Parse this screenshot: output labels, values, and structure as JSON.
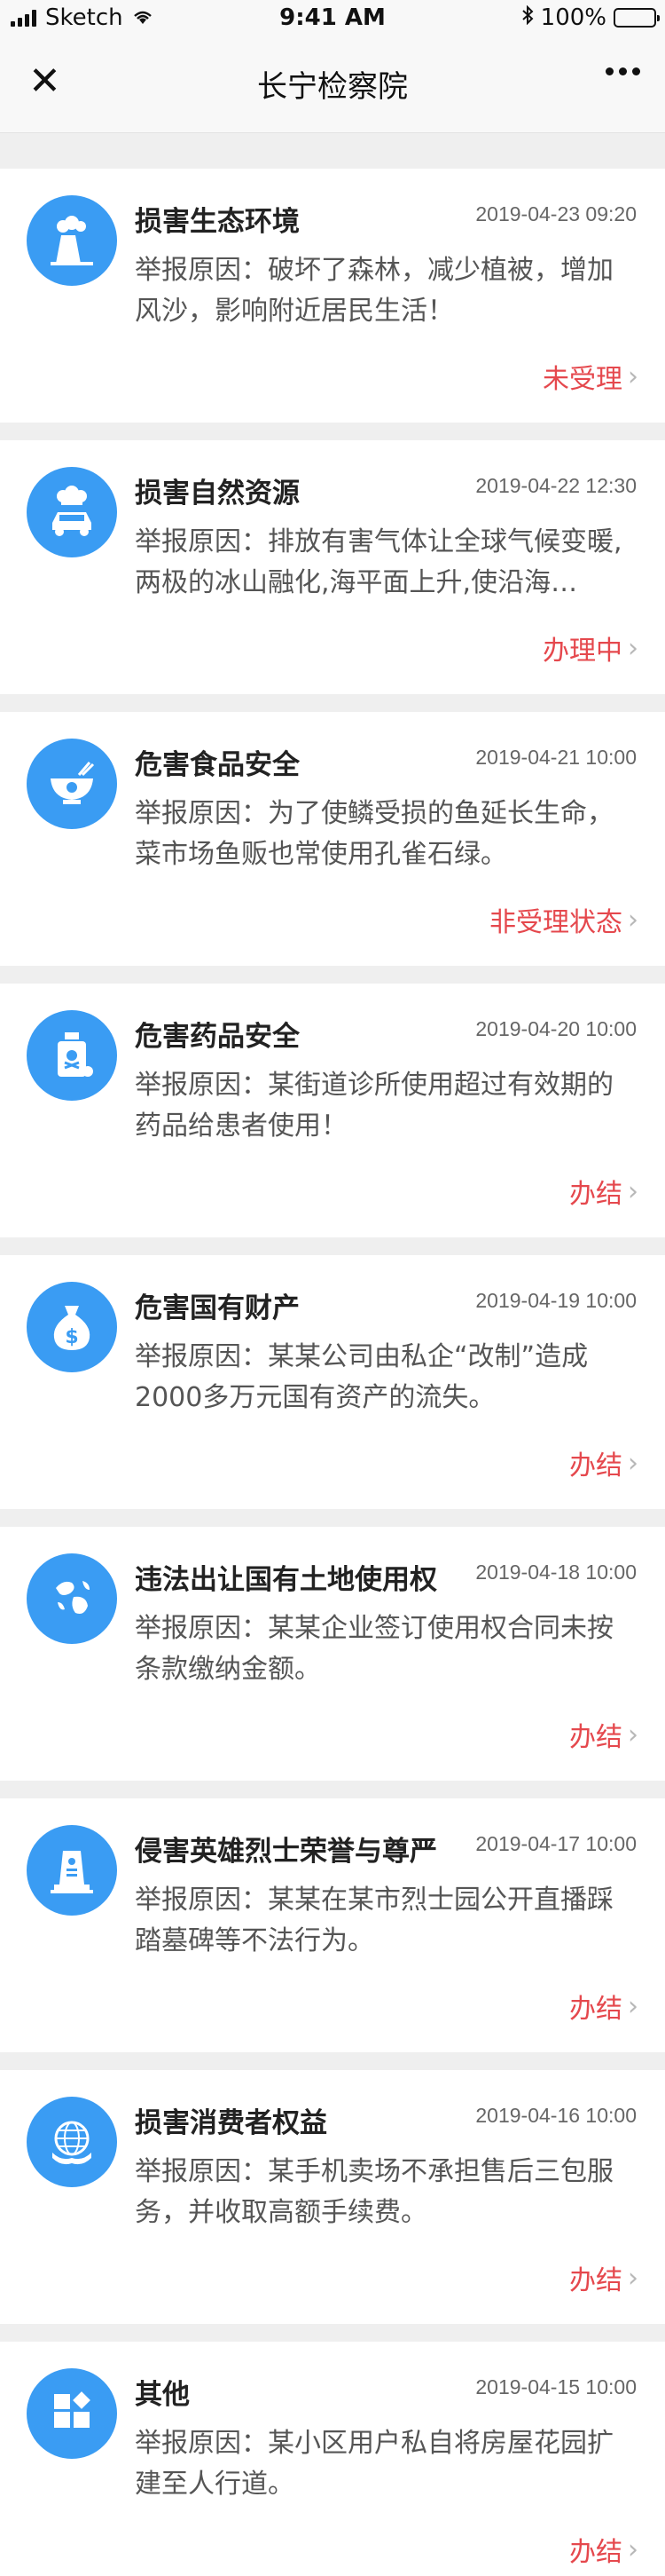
{
  "status_bar": {
    "carrier": "Sketch",
    "time": "9:41 AM",
    "battery": "100%"
  },
  "nav": {
    "title": "长宁检察院"
  },
  "items": [
    {
      "icon": "factory-icon",
      "title": "损害生态环境",
      "date": "2019-04-23 09:20",
      "desc": "举报原因：破坏了森林，减少植被，增加风沙，影响附近居民生活！",
      "status": "未受理"
    },
    {
      "icon": "car-pollution-icon",
      "title": "损害自然资源",
      "date": "2019-04-22 12:30",
      "desc": "举报原因：排放有害气体让全球气候变暖,两极的冰山融化,海平面上升,使沿海…",
      "status": "办理中"
    },
    {
      "icon": "poison-bowl-icon",
      "title": "危害食品安全",
      "date": "2019-04-21 10:00",
      "desc": "举报原因：为了使鳞受损的鱼延长生命，菜市场鱼贩也常使用孔雀石绿。",
      "status": "非受理状态"
    },
    {
      "icon": "poison-bottle-icon",
      "title": "危害药品安全",
      "date": "2019-04-20 10:00",
      "desc": "举报原因：某街道诊所使用超过有效期的药品给患者使用！",
      "status": "办结"
    },
    {
      "icon": "money-bag-icon",
      "title": "危害国有财产",
      "date": "2019-04-19 10:00",
      "desc": "举报原因：某某公司由私企“改制”造成2000多万元国有资产的流失。",
      "status": "办结"
    },
    {
      "icon": "globe-land-icon",
      "title": "违法出让国有土地使用权",
      "date": "2019-04-18 10:00",
      "desc": "举报原因：某某企业签订使用权合同未按条款缴纳金额。",
      "status": "办结"
    },
    {
      "icon": "monument-icon",
      "title": "侵害英雄烈士荣誉与尊严",
      "date": "2019-04-17 10:00",
      "desc": "举报原因：某某在某市烈士园公开直播踩踏墓碑等不法行为。",
      "status": "办结"
    },
    {
      "icon": "consumer-globe-icon",
      "title": "损害消费者权益",
      "date": "2019-04-16 10:00",
      "desc": "举报原因：某手机卖场不承担售后三包服务，并收取高额手续费。",
      "status": "办结"
    },
    {
      "icon": "grid-shapes-icon",
      "title": "其他",
      "date": "2019-04-15 10:00",
      "desc": "举报原因：某小区用户私自将房屋花园扩建至人行道。",
      "status": "办结"
    }
  ],
  "colors": {
    "accent_blue": "#3a9cf3",
    "status_red": "#e5484d",
    "background": "#efefef"
  }
}
